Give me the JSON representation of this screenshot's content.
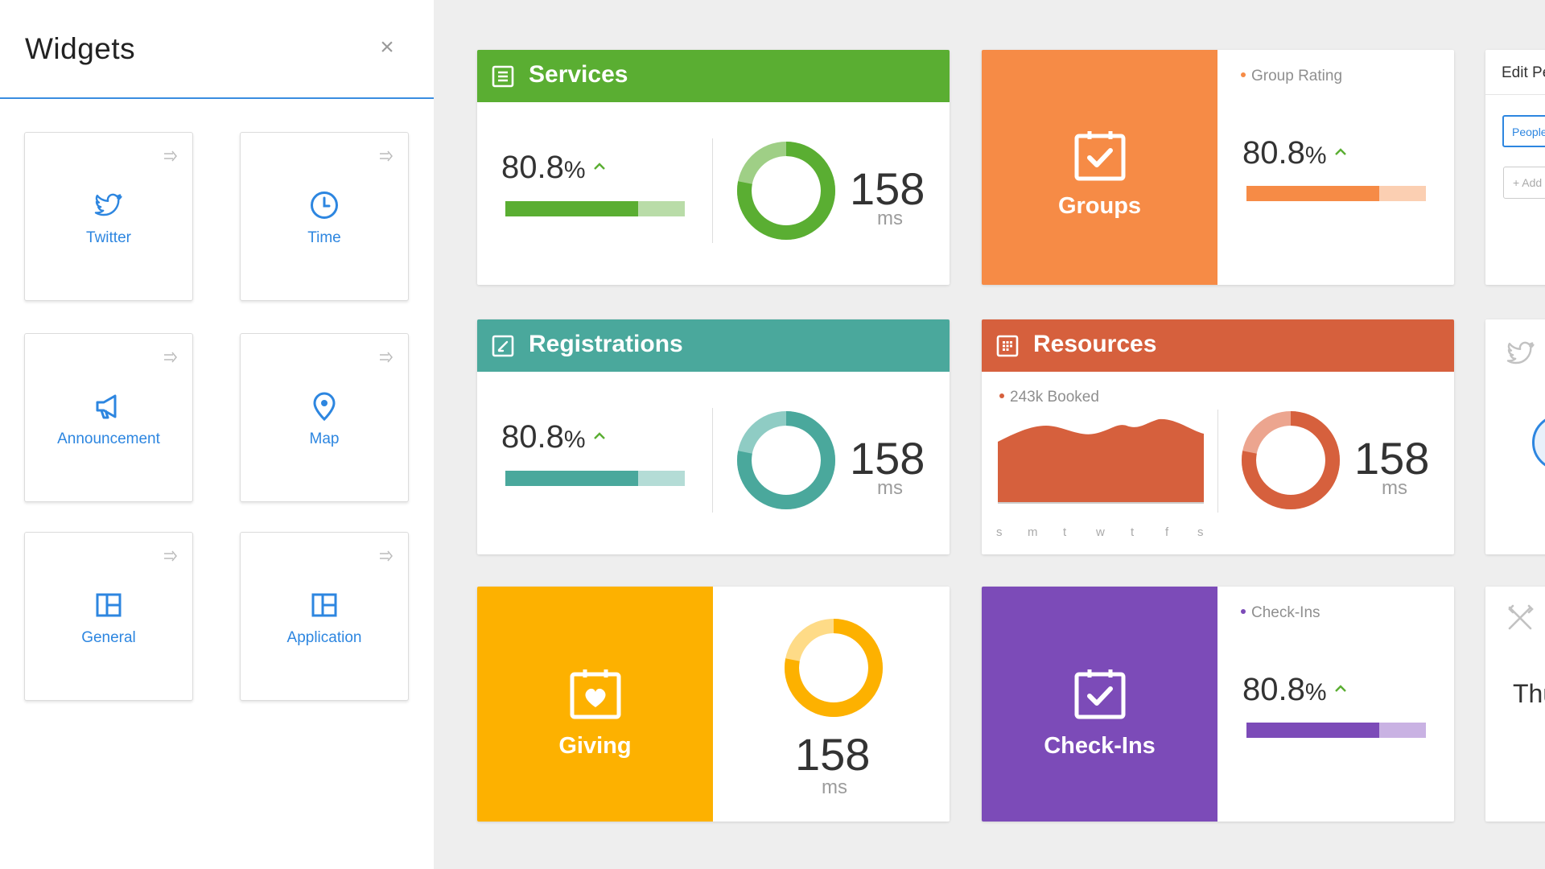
{
  "colors": {
    "accent_blue": "#2d86e0",
    "services_green": "#5aae32",
    "services_green_light": "#b9dca8",
    "registrations_teal": "#4aa89c",
    "registrations_teal_light": "#b4dcd6",
    "groups_orange": "#f68b46",
    "groups_orange_light": "#fbcfb2",
    "resources_red": "#d6603d",
    "resources_red_light": "#eca58f",
    "giving_yellow": "#fdb100",
    "giving_yellow_light": "#fedb87",
    "checkins_purple": "#7c4bb8",
    "checkins_purple_light": "#c9b2e3"
  },
  "sidebar": {
    "title": "Widgets",
    "close_icon": "close-icon",
    "widgets": [
      {
        "label": "Twitter",
        "icon": "twitter-bird-icon"
      },
      {
        "label": "Time",
        "icon": "clock-icon"
      },
      {
        "label": "Announcement",
        "icon": "megaphone-icon"
      },
      {
        "label": "Map",
        "icon": "map-pin-icon"
      },
      {
        "label": "General",
        "icon": "layout-icon"
      },
      {
        "label": "Application",
        "icon": "layout-icon"
      }
    ]
  },
  "cards": {
    "services": {
      "title": "Services",
      "icon": "list-icon",
      "percent": "80.8",
      "percent_unit": "%",
      "progress": 0.74,
      "donut_value": 0.78,
      "number": "158",
      "unit": "ms"
    },
    "groups": {
      "title": "Groups",
      "icon": "calendar-check-icon",
      "legend": "Group Rating",
      "percent": "80.8",
      "percent_unit": "%",
      "progress": 0.74
    },
    "registrations": {
      "title": "Registrations",
      "icon": "edit-icon",
      "percent": "80.8",
      "percent_unit": "%",
      "progress": 0.74,
      "donut_value": 0.78,
      "number": "158",
      "unit": "ms"
    },
    "resources": {
      "title": "Resources",
      "icon": "grid-icon",
      "legend": "243k Booked",
      "days": [
        "s",
        "m",
        "t",
        "w",
        "t",
        "f",
        "s"
      ],
      "donut_value": 0.78,
      "number": "158",
      "unit": "ms"
    },
    "giving": {
      "title": "Giving",
      "icon": "calendar-heart-icon",
      "donut_value": 0.78,
      "number": "158",
      "unit": "ms"
    },
    "checkins": {
      "title": "Check-Ins",
      "icon": "calendar-check-icon",
      "legend": "Check-Ins",
      "percent": "80.8",
      "percent_unit": "%",
      "progress": 0.74
    }
  },
  "partial": {
    "edit_title": "Edit Pe",
    "people_button": "People",
    "add_button": "+ Add",
    "twitter_icon": "twitter-bird-icon",
    "tools_icon": "tools-icon",
    "day_text": "Thu"
  }
}
